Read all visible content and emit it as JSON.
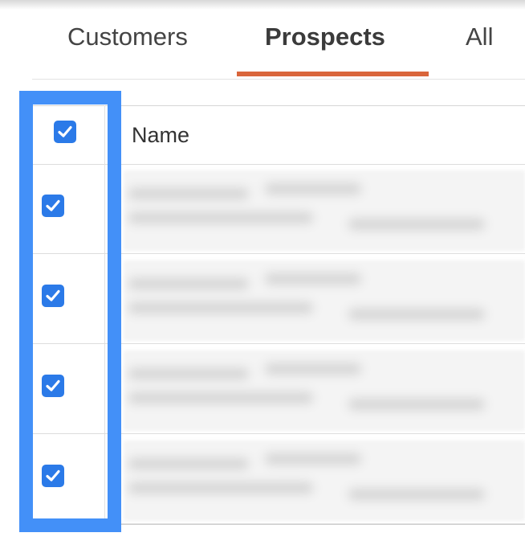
{
  "tabs": {
    "customers": "Customers",
    "prospects": "Prospects",
    "all": "All",
    "active": "Prospects"
  },
  "table": {
    "header": {
      "name_label": "Name",
      "select_all_checked": true
    },
    "rows": [
      {
        "checked": true,
        "content": "blurred"
      },
      {
        "checked": true,
        "content": "blurred"
      },
      {
        "checked": true,
        "content": "blurred"
      },
      {
        "checked": true,
        "content": "blurred"
      }
    ]
  },
  "colors": {
    "accent_underline": "#d9653b",
    "highlight_border": "#4390f8",
    "checkbox_fill": "#2b7ae8"
  },
  "icons": {
    "checkbox": "check-icon"
  }
}
